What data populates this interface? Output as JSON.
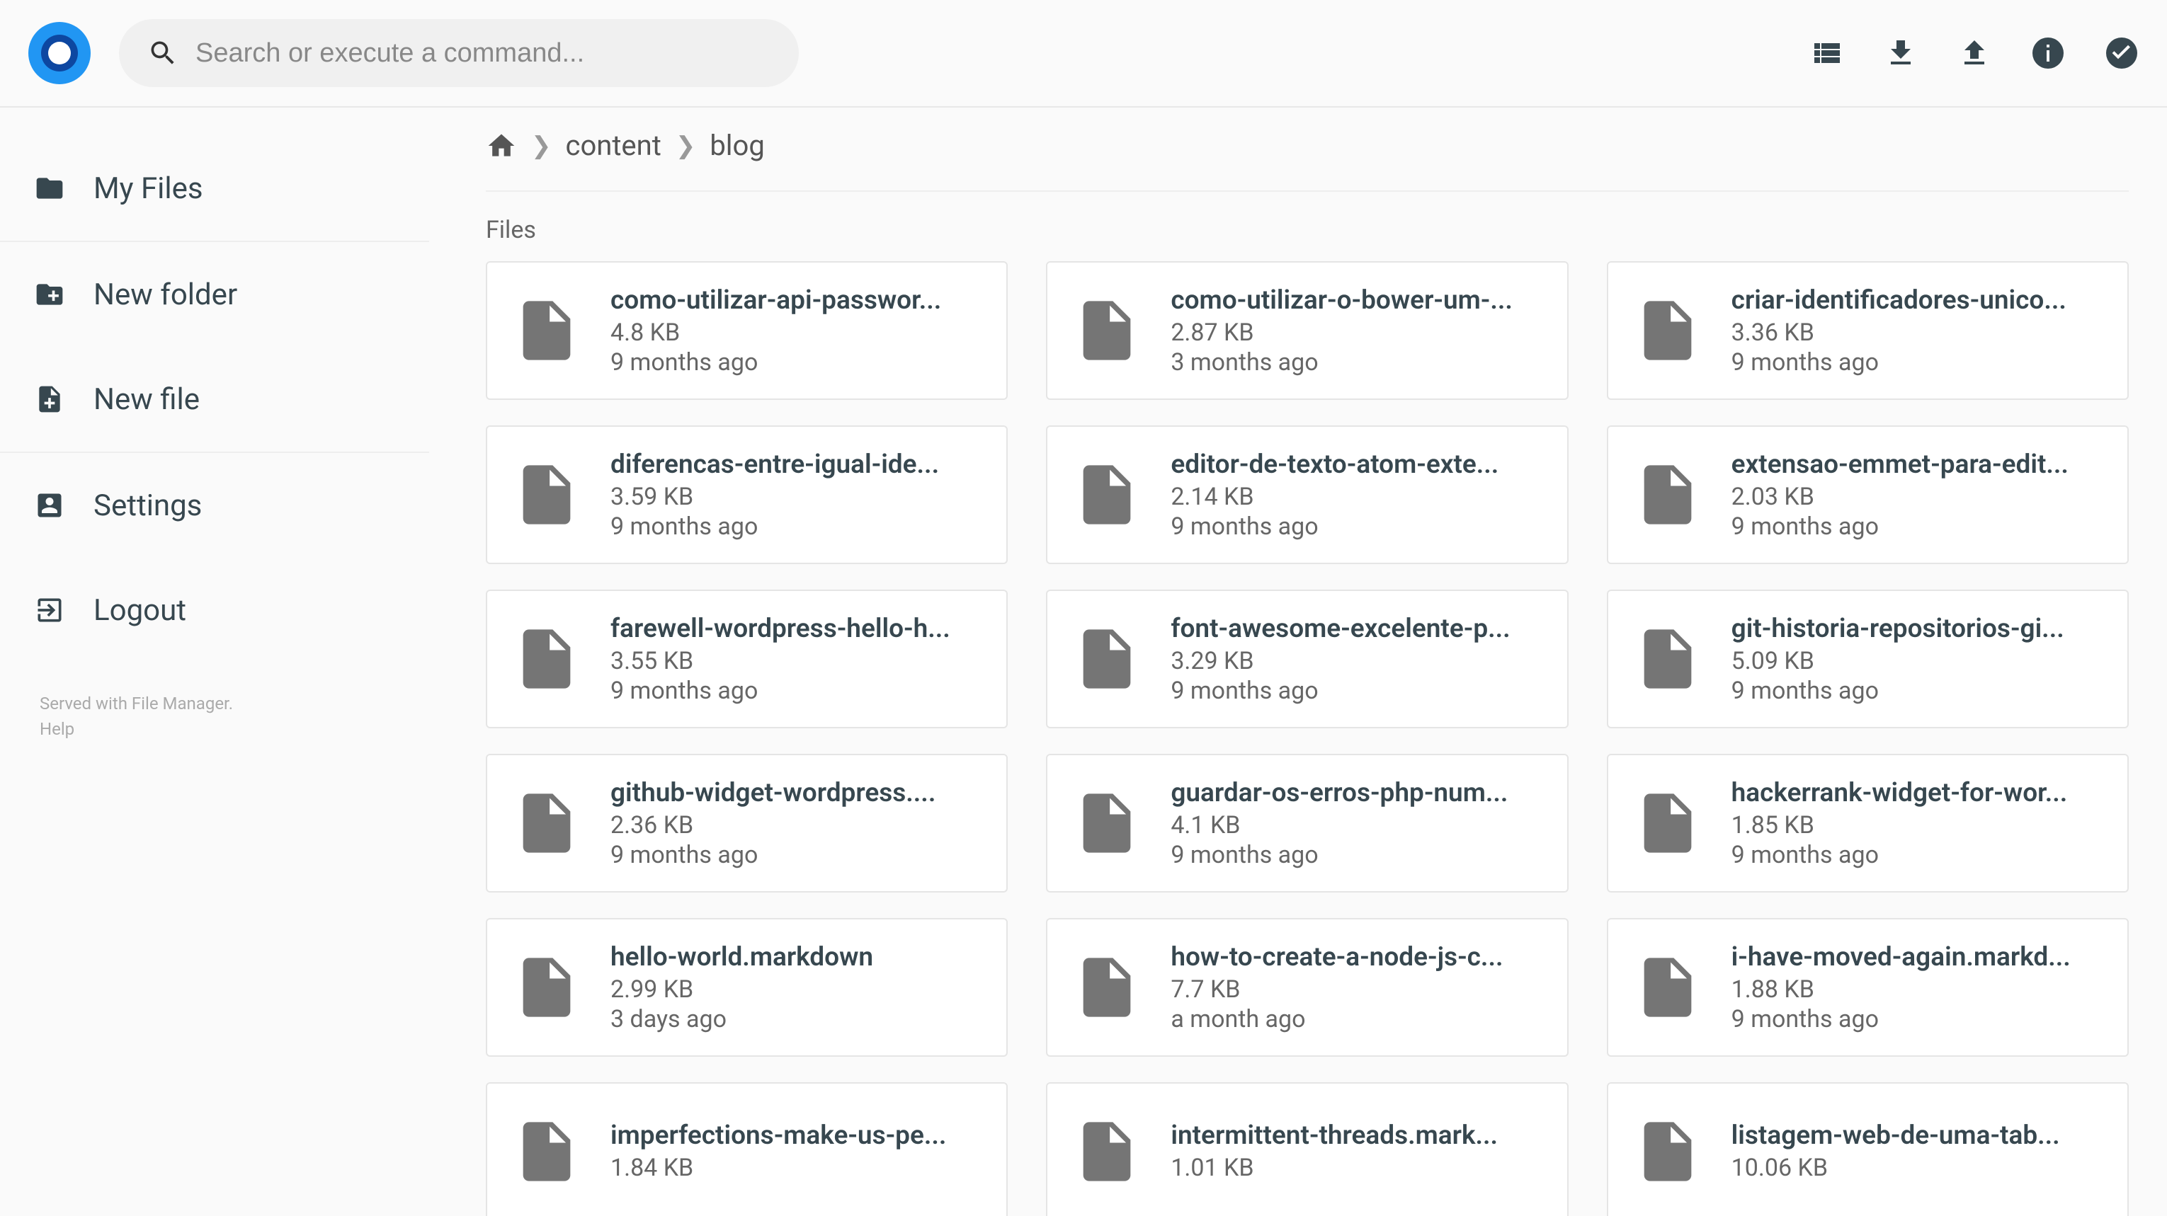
{
  "search": {
    "placeholder": "Search or execute a command..."
  },
  "sidebar": {
    "items": [
      {
        "label": "My Files"
      },
      {
        "label": "New folder"
      },
      {
        "label": "New file"
      },
      {
        "label": "Settings"
      },
      {
        "label": "Logout"
      }
    ],
    "footer_line1": "Served with File Manager.",
    "footer_line2": "Help"
  },
  "breadcrumb": {
    "items": [
      "content",
      "blog"
    ]
  },
  "section_title": "Files",
  "files": [
    {
      "name": "como-utilizar-api-passwor...",
      "size": "4.8 KB",
      "time": "9 months ago"
    },
    {
      "name": "como-utilizar-o-bower-um-...",
      "size": "2.87 KB",
      "time": "3 months ago"
    },
    {
      "name": "criar-identificadores-unico...",
      "size": "3.36 KB",
      "time": "9 months ago"
    },
    {
      "name": "diferencas-entre-igual-ide...",
      "size": "3.59 KB",
      "time": "9 months ago"
    },
    {
      "name": "editor-de-texto-atom-exte...",
      "size": "2.14 KB",
      "time": "9 months ago"
    },
    {
      "name": "extensao-emmet-para-edit...",
      "size": "2.03 KB",
      "time": "9 months ago"
    },
    {
      "name": "farewell-wordpress-hello-h...",
      "size": "3.55 KB",
      "time": "9 months ago"
    },
    {
      "name": "font-awesome-excelente-p...",
      "size": "3.29 KB",
      "time": "9 months ago"
    },
    {
      "name": "git-historia-repositorios-gi...",
      "size": "5.09 KB",
      "time": "9 months ago"
    },
    {
      "name": "github-widget-wordpress....",
      "size": "2.36 KB",
      "time": "9 months ago"
    },
    {
      "name": "guardar-os-erros-php-num...",
      "size": "4.1 KB",
      "time": "9 months ago"
    },
    {
      "name": "hackerrank-widget-for-wor...",
      "size": "1.85 KB",
      "time": "9 months ago"
    },
    {
      "name": "hello-world.markdown",
      "size": "2.99 KB",
      "time": "3 days ago"
    },
    {
      "name": "how-to-create-a-node-js-c...",
      "size": "7.7 KB",
      "time": "a month ago"
    },
    {
      "name": "i-have-moved-again.markd...",
      "size": "1.88 KB",
      "time": "9 months ago"
    },
    {
      "name": "imperfections-make-us-pe...",
      "size": "1.84 KB",
      "time": ""
    },
    {
      "name": "intermittent-threads.mark...",
      "size": "1.01 KB",
      "time": ""
    },
    {
      "name": "listagem-web-de-uma-tab...",
      "size": "10.06 KB",
      "time": ""
    }
  ]
}
